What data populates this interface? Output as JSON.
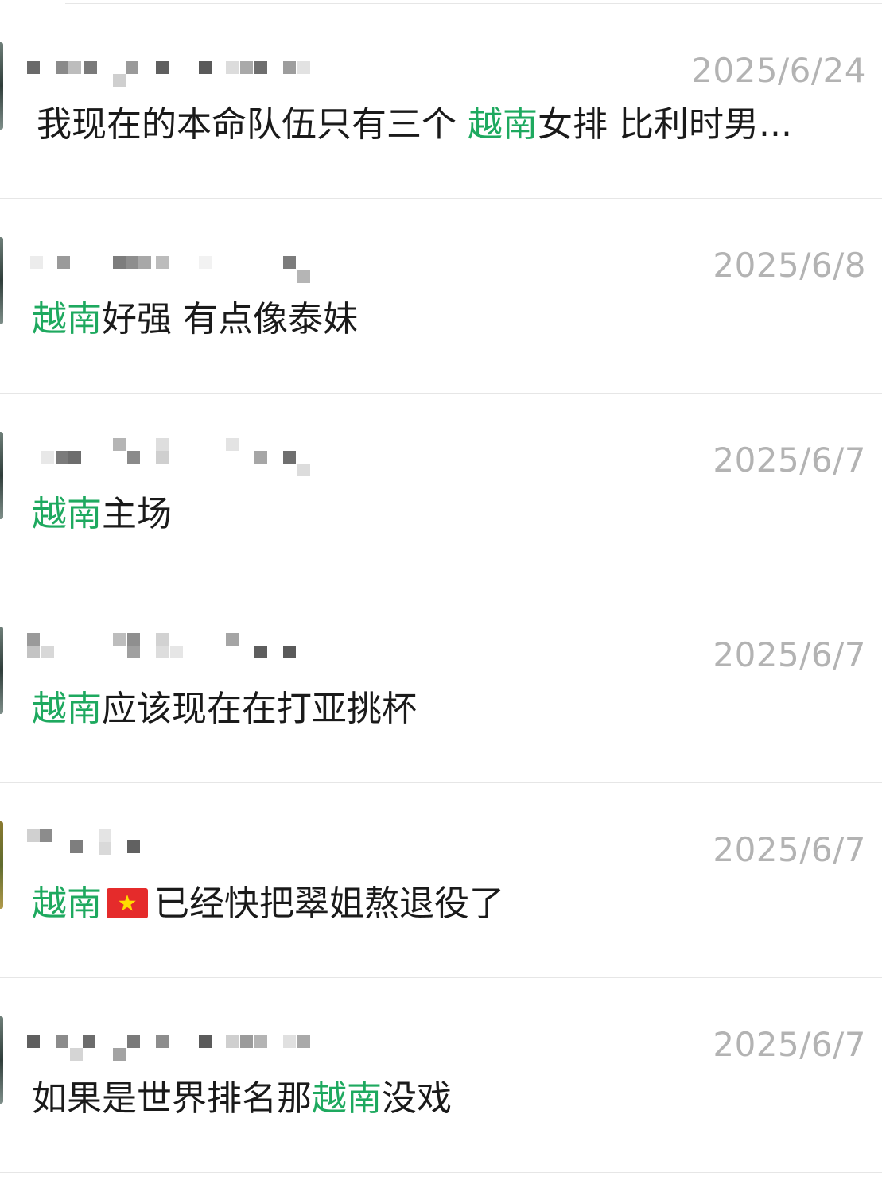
{
  "accent_color": "#1ea95f",
  "keyword": "越南",
  "comments": [
    {
      "date": "2025/6/24",
      "pre": "我现在的本命队伍只有三个 ",
      "kw": "越南",
      "post": "女排 比利时男..."
    },
    {
      "date": "2025/6/8",
      "pre": "",
      "kw": "越南",
      "post": "好强 有点像泰妹"
    },
    {
      "date": "2025/6/7",
      "pre": "",
      "kw": "越南",
      "post": "主场"
    },
    {
      "date": "2025/6/7",
      "pre": "",
      "kw": "越南",
      "post": "应该现在在打亚挑杯"
    },
    {
      "date": "2025/6/7",
      "pre": "",
      "kw": "越南",
      "flag": "vietnam-flag-icon",
      "post": "已经快把翠姐熬退役了"
    },
    {
      "date": "2025/6/7",
      "pre": "如果是世界排名那",
      "kw": "越南",
      "post": "没戏"
    }
  ]
}
